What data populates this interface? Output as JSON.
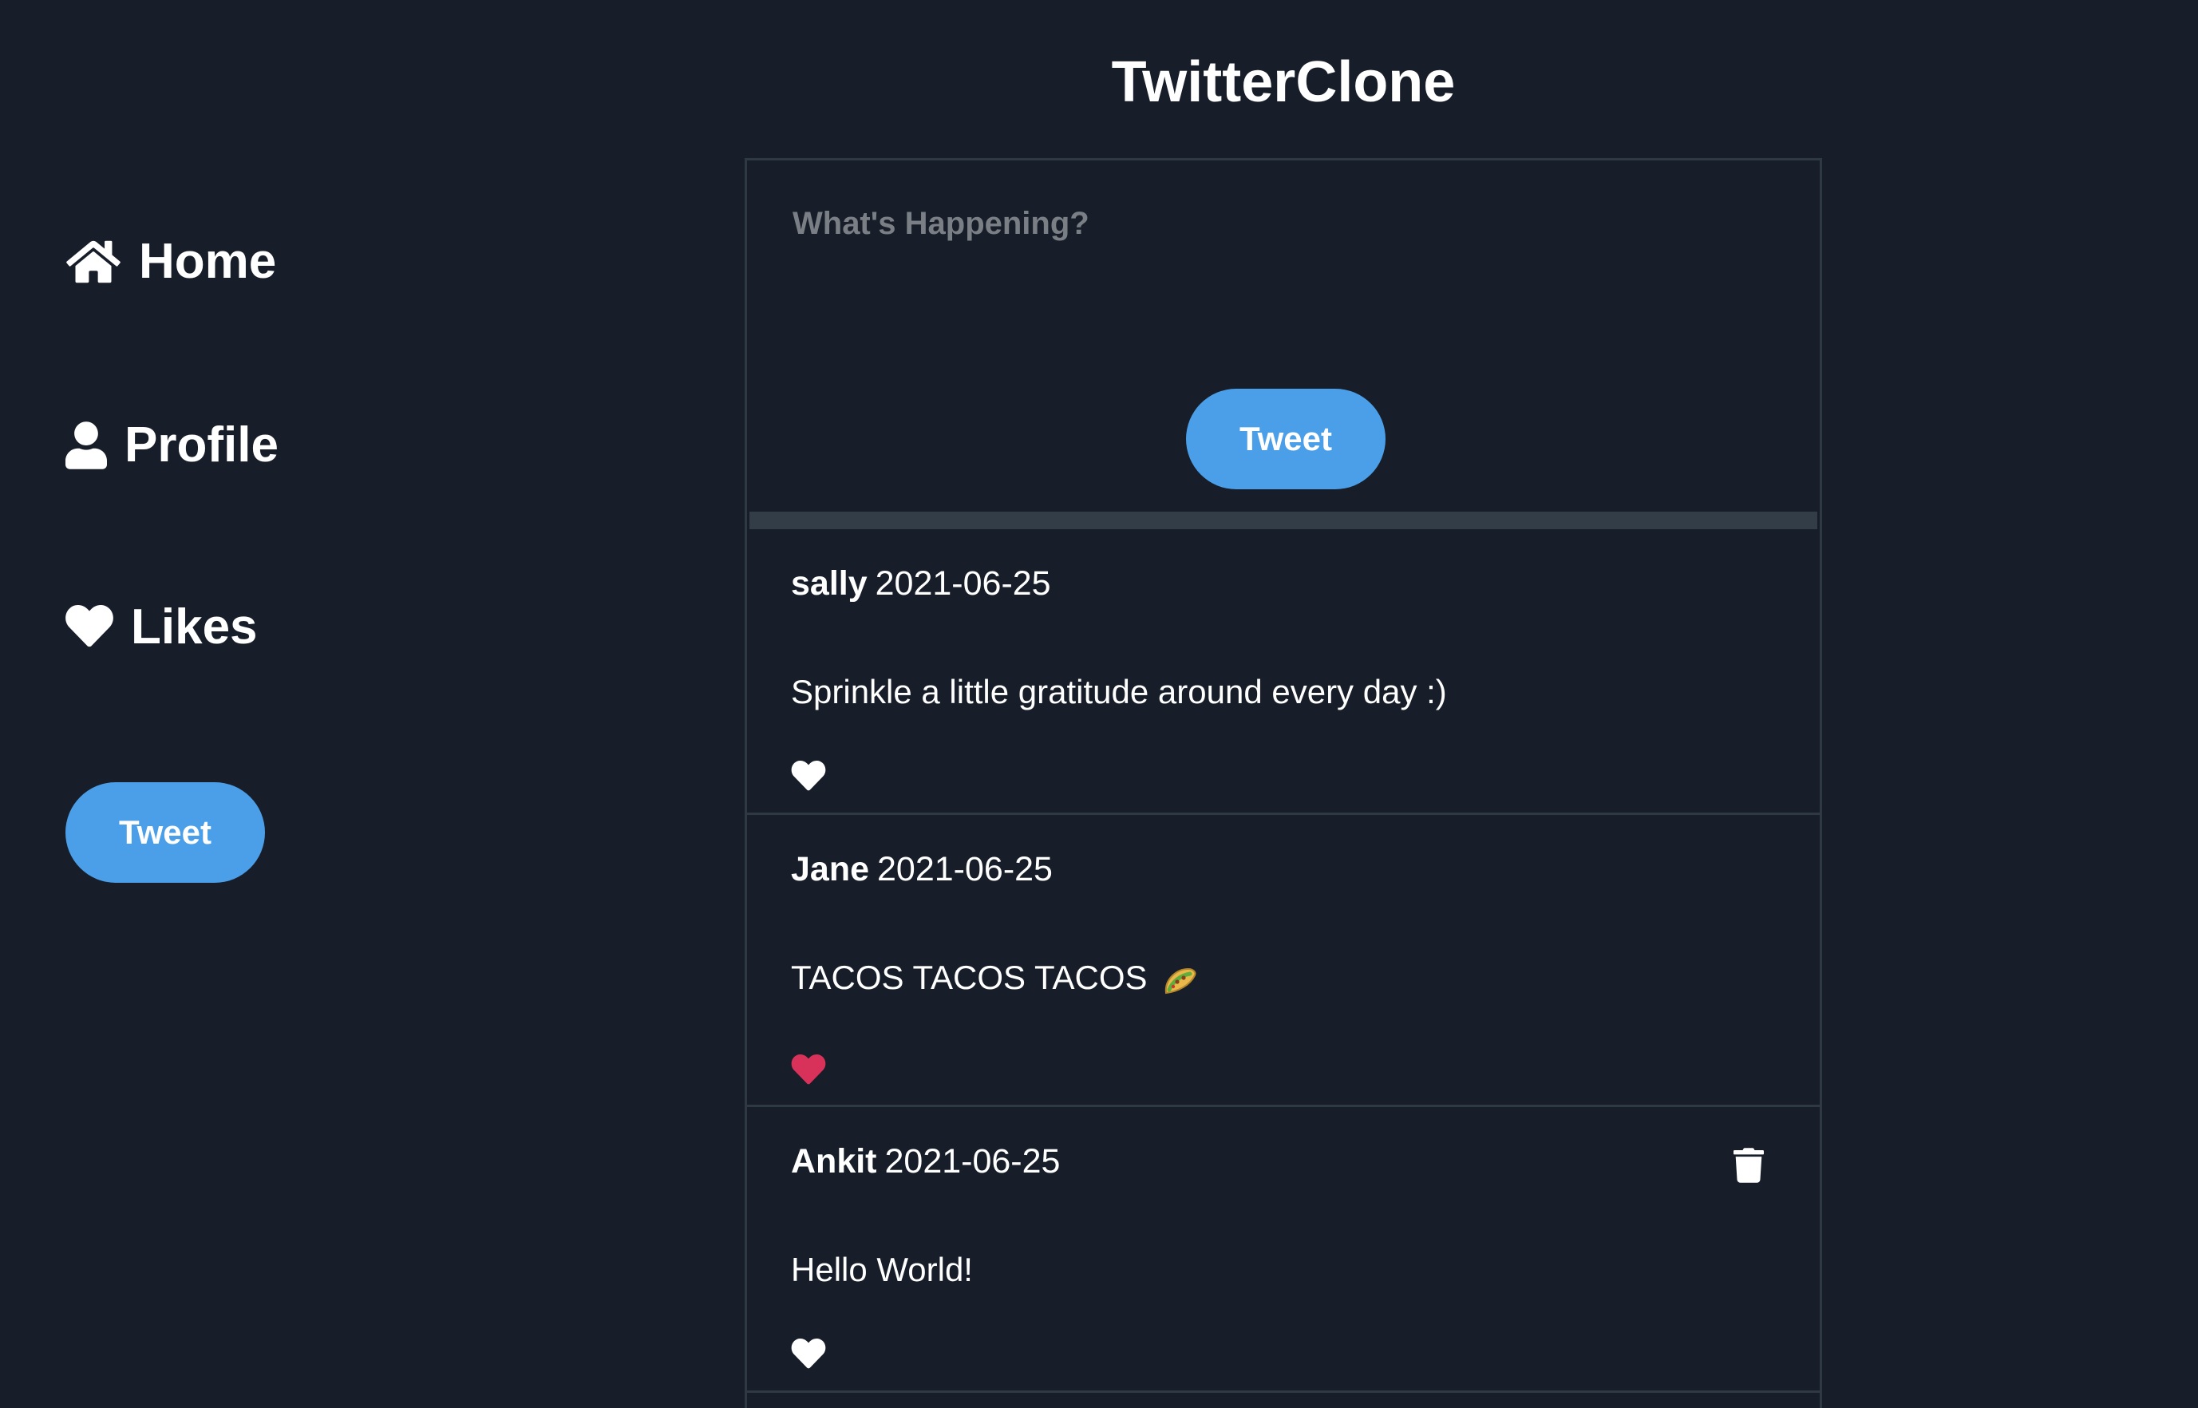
{
  "app": {
    "title": "TwitterClone"
  },
  "sidebar": {
    "items": [
      {
        "label": "Home",
        "icon": "home-icon"
      },
      {
        "label": "Profile",
        "icon": "user-icon"
      },
      {
        "label": "Likes",
        "icon": "heart-icon"
      }
    ],
    "tweet_button": "Tweet"
  },
  "composer": {
    "placeholder": "What's Happening?",
    "value": "",
    "tweet_button": "Tweet"
  },
  "tweets": [
    {
      "user": "sally",
      "date": "2021-06-25",
      "text": "Sprinkle a little gratitude around every day :)",
      "liked": false,
      "deletable": false
    },
    {
      "user": "Jane",
      "date": "2021-06-25",
      "text": "TACOS TACOS TACOS",
      "emoji": "taco-emoji",
      "liked": true,
      "deletable": false
    },
    {
      "user": "Ankit",
      "date": "2021-06-25",
      "text": "Hello World!",
      "liked": false,
      "deletable": true
    }
  ],
  "colors": {
    "background": "#171e29",
    "accent": "#4b9fe8",
    "liked": "#d8325a",
    "border": "#2f3943"
  }
}
